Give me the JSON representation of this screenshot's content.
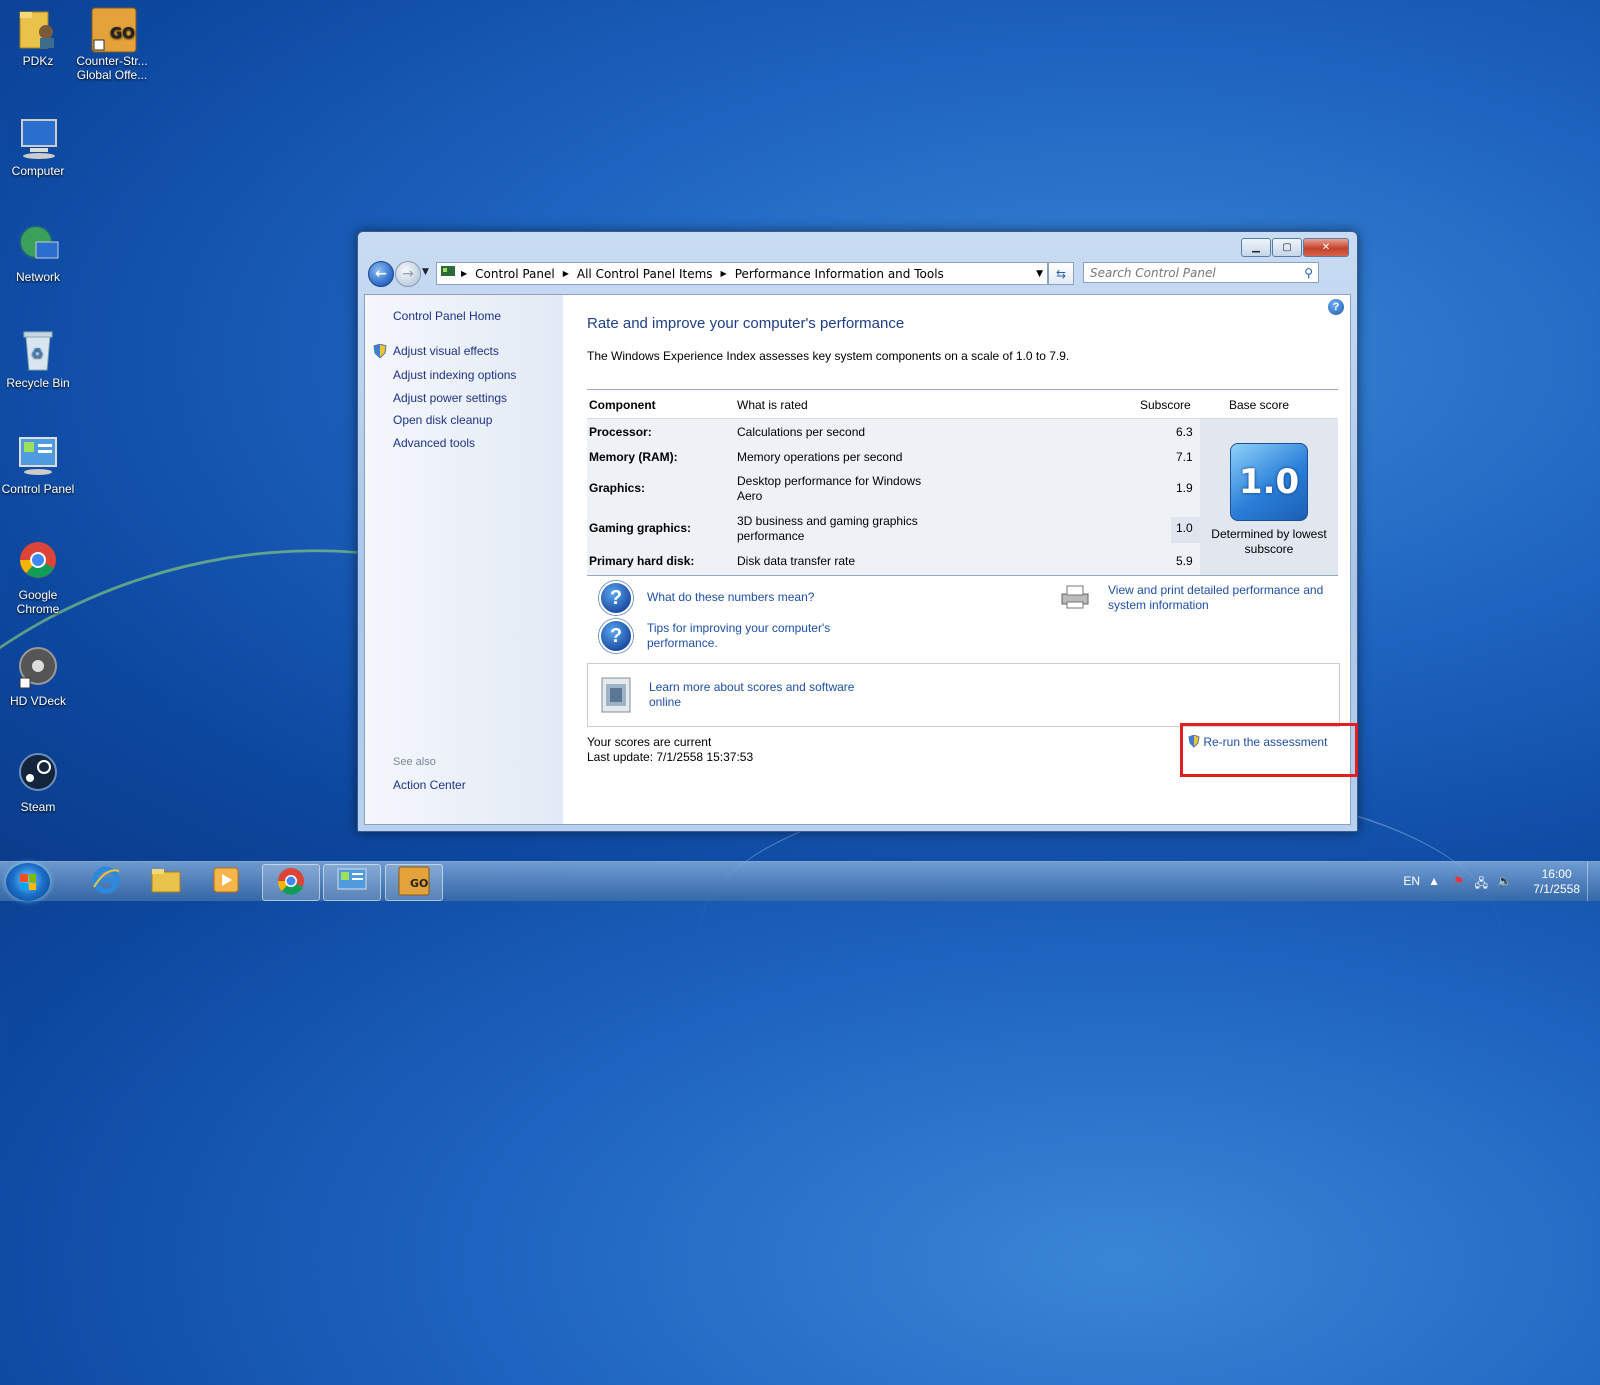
{
  "desktop": {
    "icons": [
      {
        "label": "PDKz"
      },
      {
        "label": "Counter-Str... Global Offe..."
      },
      {
        "label": "Computer"
      },
      {
        "label": "Network"
      },
      {
        "label": "Recycle Bin"
      },
      {
        "label": "Control Panel"
      },
      {
        "label": "Google Chrome"
      },
      {
        "label": "HD VDeck"
      },
      {
        "label": "Steam"
      }
    ]
  },
  "window": {
    "breadcrumb": [
      "Control Panel",
      "All Control Panel Items",
      "Performance Information and Tools"
    ],
    "search_placeholder": "Search Control Panel",
    "sidebar": {
      "home": "Control Panel Home",
      "links": [
        "Adjust visual effects",
        "Adjust indexing options",
        "Adjust power settings",
        "Open disk cleanup",
        "Advanced tools"
      ],
      "see_also_label": "See also",
      "see_also_links": [
        "Action Center"
      ]
    },
    "main": {
      "title": "Rate and improve your computer's performance",
      "description": "The Windows Experience Index assesses key system components on a scale of 1.0 to 7.9.",
      "table": {
        "headers": {
          "component": "Component",
          "what": "What is rated",
          "subscore": "Subscore",
          "base": "Base score"
        },
        "rows": [
          {
            "component": "Processor:",
            "what": "Calculations per second",
            "subscore": "6.3"
          },
          {
            "component": "Memory (RAM):",
            "what": "Memory operations per second",
            "subscore": "7.1"
          },
          {
            "component": "Graphics:",
            "what": "Desktop performance for Windows Aero",
            "subscore": "1.9"
          },
          {
            "component": "Gaming graphics:",
            "what": "3D business and gaming graphics performance",
            "subscore": "1.0"
          },
          {
            "component": "Primary hard disk:",
            "what": "Disk data transfer rate",
            "subscore": "5.9"
          }
        ],
        "base_score": "1.0",
        "base_caption": "Determined by lowest subscore"
      },
      "links": {
        "numbers": "What do these numbers mean?",
        "tips": "Tips for improving your computer's performance.",
        "print": "View and print detailed performance and system information",
        "learn": "Learn more about scores and software online"
      },
      "status_line1": "Your scores are current",
      "status_line2": "Last update: 7/1/2558 15:37:53",
      "rerun": "Re-run the assessment"
    }
  },
  "taskbar": {
    "language": "EN",
    "time": "16:00",
    "date": "7/1/2558"
  }
}
